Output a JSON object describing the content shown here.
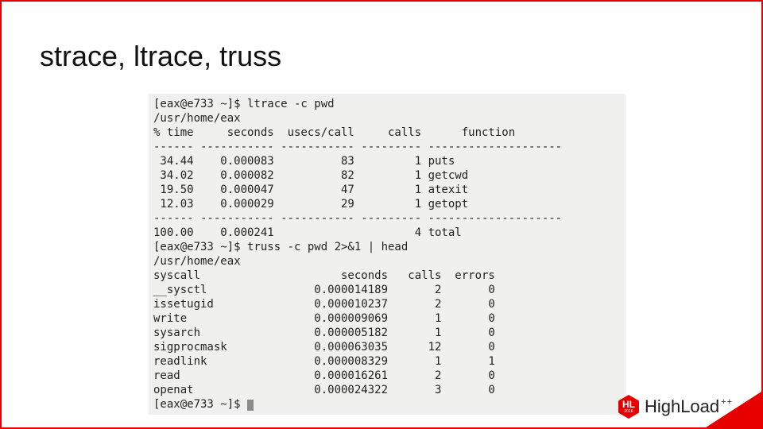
{
  "title": "strace, ltrace, truss",
  "term": {
    "cmd1": "[eax@e733 ~]$ ltrace -c pwd",
    "out1": "/usr/home/eax",
    "hdr1": "% time     seconds  usecs/call     calls      function",
    "sep1": "------ ----------- ----------- --------- --------------------",
    "r1": " 34.44    0.000083          83         1 puts",
    "r2": " 34.02    0.000082          82         1 getcwd",
    "r3": " 19.50    0.000047          47         1 atexit",
    "r4": " 12.03    0.000029          29         1 getopt",
    "sep2": "------ ----------- ----------- --------- --------------------",
    "tot": "100.00    0.000241                     4 total",
    "cmd2": "[eax@e733 ~]$ truss -c pwd 2>&1 | head",
    "out2": "/usr/home/eax",
    "hdr2": "syscall                     seconds   calls  errors",
    "s1": "__sysctl                0.000014189       2       0",
    "s2": "issetugid               0.000010237       2       0",
    "s3": "write                   0.000009069       1       0",
    "s4": "sysarch                 0.000005182       1       0",
    "s5": "sigprocmask             0.000063035      12       0",
    "s6": "readlink                0.000008329       1       1",
    "s7": "read                    0.000016261       2       0",
    "s8": "openat                  0.000024322       3       0",
    "prompt": "[eax@e733 ~]$ "
  },
  "logo": {
    "letters": "HL",
    "year": "2016",
    "word_light": "High",
    "word_bold": "Load",
    "plus": "++"
  }
}
